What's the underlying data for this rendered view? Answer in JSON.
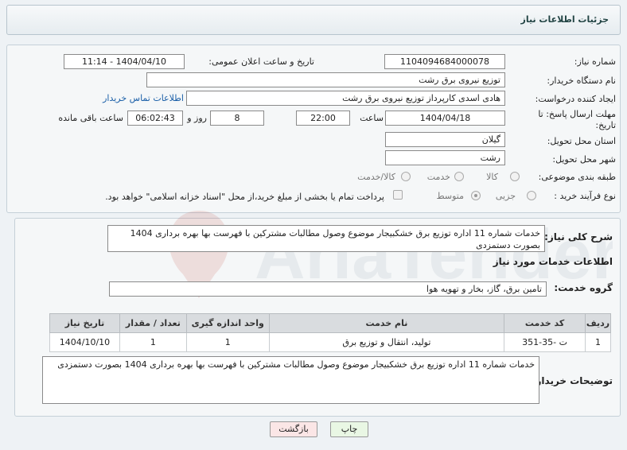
{
  "header": {
    "title": "جزئیات اطلاعات نیاز"
  },
  "fields": {
    "need_number_label": "شماره نیاز:",
    "need_number": "1104094684000078",
    "announce_label": "تاریخ و ساعت اعلان عمومی:",
    "announce_value": "1404/04/10 - 11:14",
    "buyer_label": "نام دستگاه خریدار:",
    "buyer_value": "توزیع نیروی برق رشت",
    "creator_label": "ایجاد کننده درخواست:",
    "creator_value": "هادی  اسدی کارپرداز توزیع نیروی برق رشت",
    "contact_link": "اطلاعات تماس خریدار",
    "deadline_label": "مهلت ارسال پاسخ: تا تاریخ:",
    "deadline_date": "1404/04/18",
    "hour_label": "ساعت",
    "deadline_time": "22:00",
    "days_value": "8",
    "days_label": "روز و",
    "remaining_time": "06:02:43",
    "remaining_label": "ساعت باقی مانده",
    "province_label": "استان محل تحویل:",
    "province_value": "گیلان",
    "city_label": "شهر محل تحویل:",
    "city_value": "رشت",
    "category_label": "طبقه بندی موضوعی:",
    "category_options": [
      "کالا",
      "خدمت",
      "کالا/خدمت"
    ],
    "purchase_label": "نوع فرآیند خرید :",
    "purchase_options": [
      "جزیی",
      "متوسط"
    ],
    "payment_note": "پرداخت تمام یا بخشی از مبلغ خرید،از محل \"اسناد خزانه اسلامی\" خواهد بود."
  },
  "description": {
    "label": "شرح کلی نیاز:",
    "text": "خدمات شماره 11 اداره توزیع برق خشکبیجار موضوع وصول مطالبات مشترکین با فهرست بها بهره برداری 1404 بصورت دستمزدی"
  },
  "services": {
    "section_title": "اطلاعات خدمات مورد نیاز",
    "group_label": "گروه خدمت:",
    "group_value": "تامین برق، گاز، بخار و تهویه هوا",
    "columns": [
      "ردیف",
      "کد خدمت",
      "نام خدمت",
      "واحد اندازه گیری",
      "تعداد / مقدار",
      "تاریخ نیاز"
    ],
    "rows": [
      [
        "1",
        "ت -35-351",
        "تولید، انتقال و توزیع برق",
        "1",
        "1",
        "1404/10/10"
      ]
    ]
  },
  "buyer_notes": {
    "label": "توضیحات خریدار:",
    "text": "خدمات شماره 11 اداره توزیع برق خشکبیجار موضوع وصول مطالبات مشترکین با فهرست بها بهره برداری 1404 بصورت دستمزدی"
  },
  "buttons": {
    "print": "چاپ",
    "back": "بازگشت"
  },
  "watermark": "AriaTender.net",
  "colors": {
    "link": "#1a5fa8",
    "print_bg": "#e9f7e4",
    "back_bg": "#fbe6e6"
  }
}
